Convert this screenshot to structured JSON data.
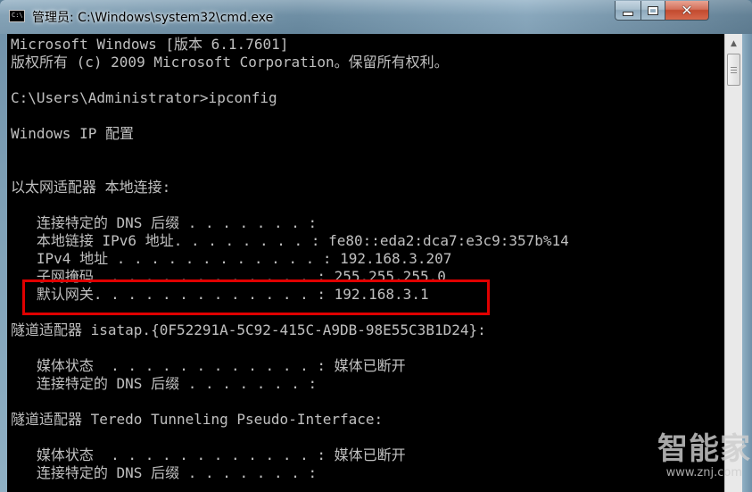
{
  "window": {
    "title": "管理员: C:\\Windows\\system32\\cmd.exe",
    "icon": "cmd-app-icon",
    "icon_text": "C:\\",
    "buttons": {
      "minimize": "minimize-icon",
      "maximize": "maximize-icon",
      "close": "close-icon",
      "close_glyph": "✕"
    }
  },
  "console": {
    "lines": [
      "Microsoft Windows [版本 6.1.7601]",
      "版权所有 (c) 2009 Microsoft Corporation。保留所有权利。",
      "",
      "C:\\Users\\Administrator>ipconfig",
      "",
      "Windows IP 配置",
      "",
      "",
      "以太网适配器 本地连接:",
      "",
      "   连接特定的 DNS 后缀 . . . . . . . :",
      "   本地链接 IPv6 地址. . . . . . . . : fe80::eda2:dca7:e3c9:357b%14",
      "   IPv4 地址 . . . . . . . . . . . . : 192.168.3.207",
      "   子网掩码  . . . . . . . . . . . . : 255.255.255.0",
      "   默认网关. . . . . . . . . . . . . : 192.168.3.1",
      "隧道适配器 isatap.{0F52291A-5C92-415C-A9DB-98E55C3B1D24}:",
      "",
      "   媒体状态  . . . . . . . . . . . . : 媒体已断开",
      "   连接特定的 DNS 后缀 . . . . . . . :",
      "",
      "隧道适配器 Teredo Tunneling Pseudo-Interface:",
      "",
      "   媒体状态  . . . . . . . . . . . . : 媒体已断开",
      "   连接特定的 DNS 后缀 . . . . . . . :"
    ],
    "text_color": "#c0c0c0",
    "background": "#000000"
  },
  "highlight": {
    "color": "#e00000",
    "target": "默认网关"
  },
  "watermark": {
    "brand": "智能家",
    "site": "www.znj.com"
  }
}
